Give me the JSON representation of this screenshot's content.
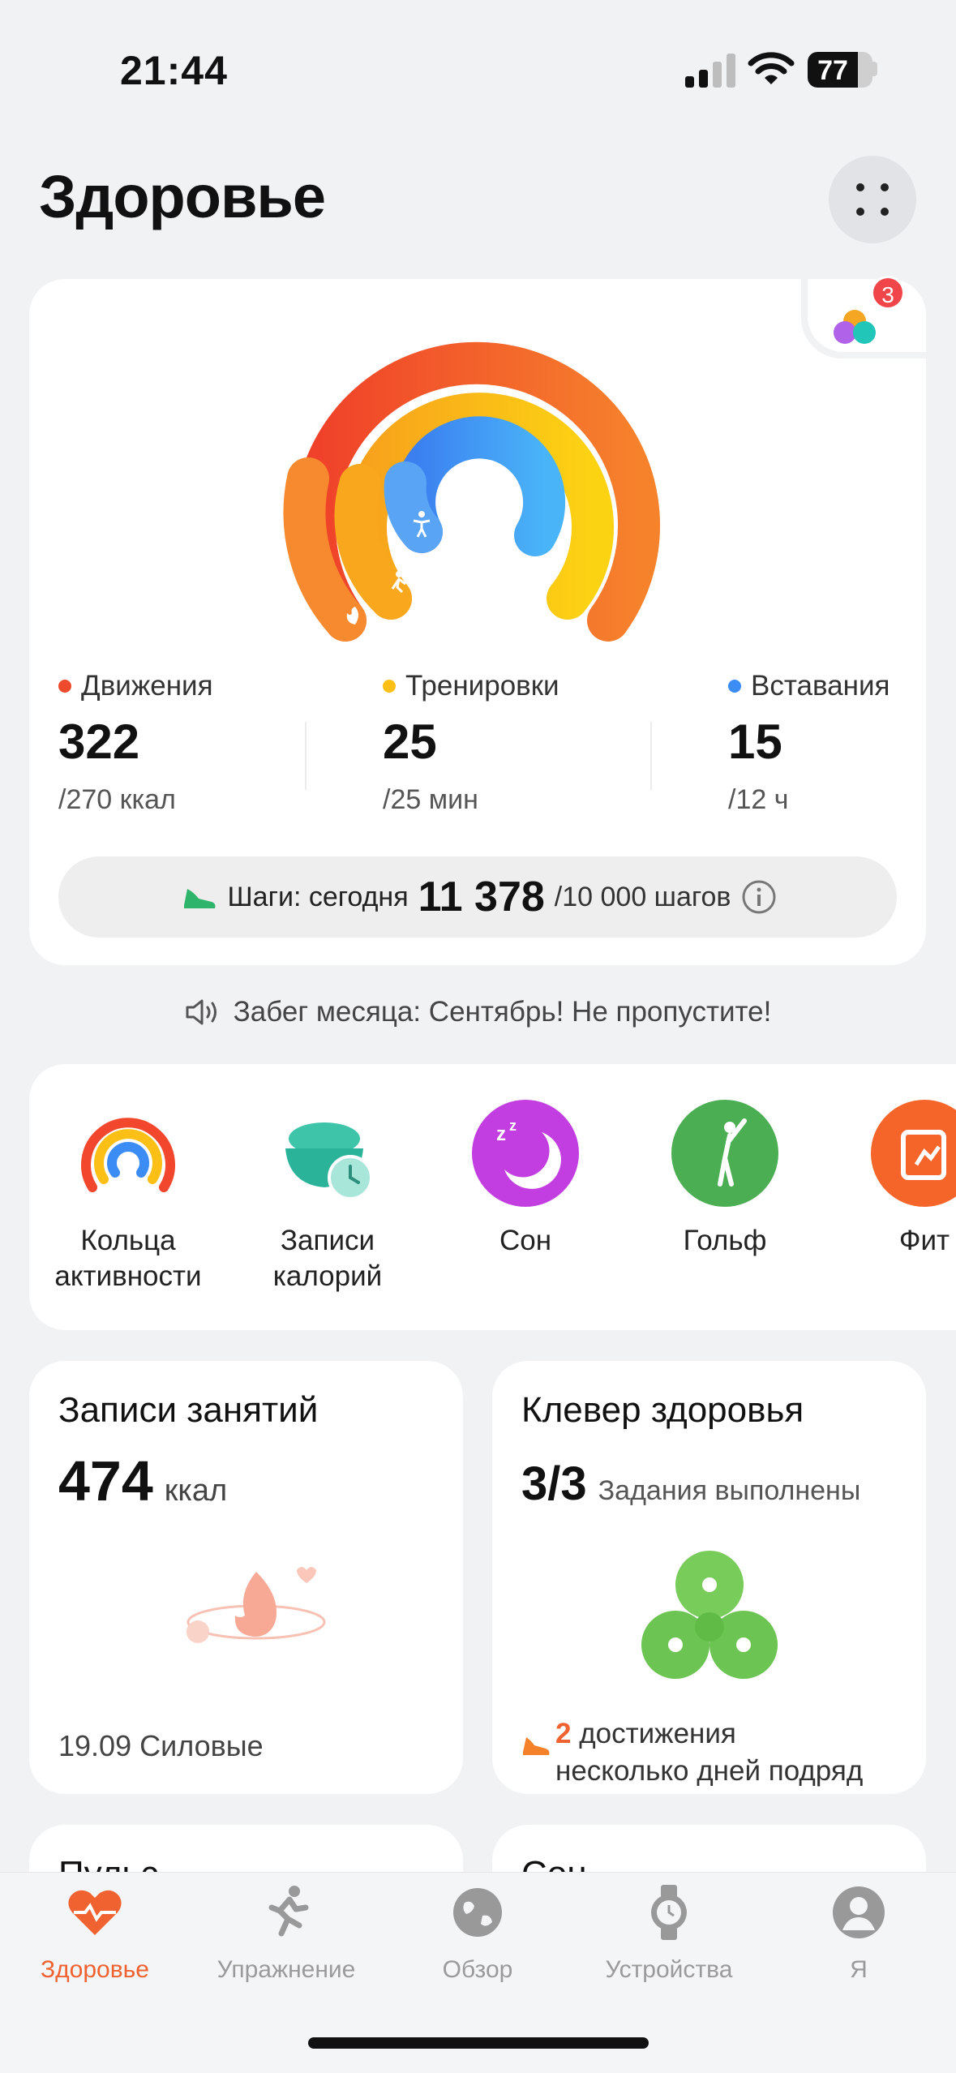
{
  "status_bar": {
    "time": "21:44",
    "battery": "77"
  },
  "header": {
    "title": "Здоровье"
  },
  "rings": {
    "badge_count": "3",
    "stats": [
      {
        "label": "Движения",
        "value": "322",
        "goal": "/270 ккал",
        "color": "#f04a2c"
      },
      {
        "label": "Тренировки",
        "value": "25",
        "goal": "/25 мин",
        "color": "#fbbf16"
      },
      {
        "label": "Вставания",
        "value": "15",
        "goal": "/12 ч",
        "color": "#3b8cf5"
      }
    ],
    "steps": {
      "label": "Шаги: сегодня",
      "value": "11 378",
      "goal": "/10 000 шагов"
    }
  },
  "banner": {
    "text": "Забег месяца: Сентябрь! Не пропустите!"
  },
  "shortcuts": [
    {
      "label_line1": "Кольца",
      "label_line2": "активности",
      "icon": "activity-rings-icon"
    },
    {
      "label_line1": "Записи",
      "label_line2": "калорий",
      "icon": "calorie-bowl-icon"
    },
    {
      "label_line1": "Сон",
      "label_line2": "",
      "icon": "sleep-moon-icon"
    },
    {
      "label_line1": "Гольф",
      "label_line2": "",
      "icon": "golf-icon"
    },
    {
      "label_line1": "Фит",
      "label_line2": "",
      "icon": "fitness-icon"
    }
  ],
  "workout_tile": {
    "title": "Записи занятий",
    "value": "474",
    "unit": "ккал",
    "last": "19.09 Силовые"
  },
  "clover_tile": {
    "title": "Клевер здоровья",
    "value": "3/3",
    "status": "Задания выполнены",
    "streak_count": "2",
    "streak_text1": "достижения",
    "streak_text2": "несколько дней подряд"
  },
  "peek_tiles": {
    "left": "Пульс",
    "right": "Сон"
  },
  "tabs": [
    {
      "label": "Здоровье",
      "active": true
    },
    {
      "label": "Упражнение",
      "active": false
    },
    {
      "label": "Обзор",
      "active": false
    },
    {
      "label": "Устройства",
      "active": false
    },
    {
      "label": "Я",
      "active": false
    }
  ],
  "colors": {
    "accent": "#f0622f",
    "move": "#f04a2c",
    "exercise": "#fbbf16",
    "stand": "#3b8cf5",
    "clover": "#78cc5a"
  }
}
